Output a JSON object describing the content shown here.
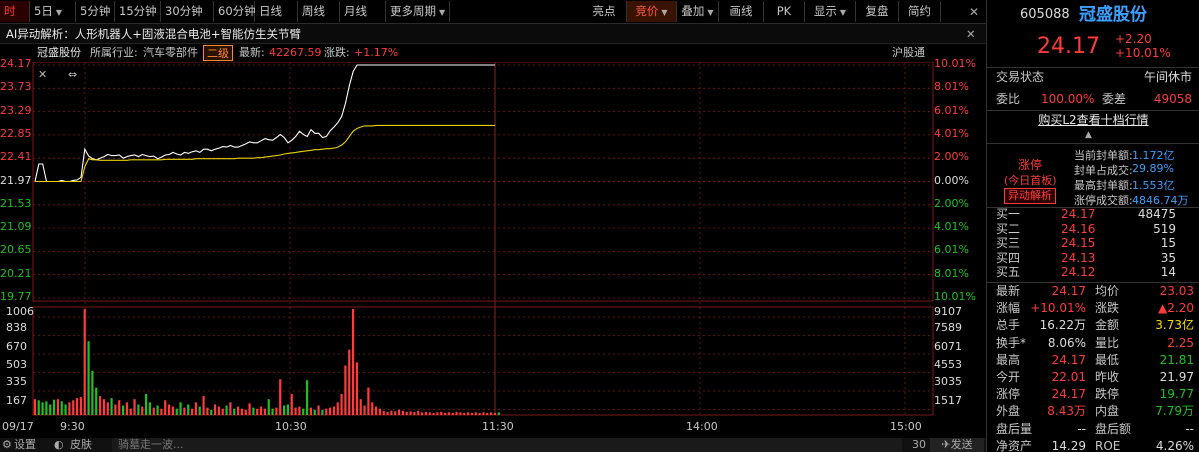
{
  "toolbar": {
    "left_items": [
      {
        "label": "时"
      },
      {
        "label": "5日"
      },
      {
        "label": "5分钟"
      },
      {
        "label": "15分钟"
      },
      {
        "label": "30分钟"
      },
      {
        "label": "60分钟"
      },
      {
        "label": "日线"
      },
      {
        "label": "周线"
      },
      {
        "label": "月线"
      },
      {
        "label": "更多周期"
      }
    ],
    "right_items": [
      {
        "label": "亮点"
      },
      {
        "label": "竞价"
      },
      {
        "label": "叠加"
      },
      {
        "label": "画线"
      },
      {
        "label": "PK"
      },
      {
        "label": "显示"
      },
      {
        "label": "复盘"
      },
      {
        "label": "简约"
      }
    ]
  },
  "ai_bar": {
    "text": "AI异动解析：人形机器人+固液混合电池+智能仿生关节臂"
  },
  "chart_header": {
    "name": "冠盛股份",
    "industry_label": "所属行业:",
    "industry": "汽车零部件",
    "level": "二级",
    "latest_label": "最新:",
    "latest": "42267.59",
    "change_label": "涨跌:",
    "change": "+1.17%",
    "connect": "沪股通"
  },
  "price_axis": {
    "left": [
      "24.17",
      "23.73",
      "23.29",
      "22.85",
      "22.41",
      "21.97",
      "21.53",
      "21.09",
      "20.65",
      "20.21",
      "19.77"
    ],
    "right": [
      "10.01%",
      "8.01%",
      "6.01%",
      "4.01%",
      "2.00%",
      "0.00%",
      "2.00%",
      "4.01%",
      "6.01%",
      "8.01%",
      "10.01%"
    ]
  },
  "volume_axis": {
    "left": [
      "1006",
      "838",
      "670",
      "503",
      "335",
      "167"
    ],
    "right": [
      "9107",
      "7589",
      "6071",
      "4553",
      "3035",
      "1517"
    ]
  },
  "time_axis": [
    "09/17",
    "9:30",
    "10:30",
    "11:30",
    "14:00",
    "15:00"
  ],
  "bottom_bar": {
    "settings": "设置",
    "skin": "皮肤",
    "ticker": "骑墓走一波...",
    "count": "30",
    "send": "发送"
  },
  "chart_data": {
    "type": "line",
    "ylim": [
      19.77,
      24.17
    ],
    "prev_close": 21.97,
    "series": [
      {
        "values": [
          21.97,
          22.3,
          22.3,
          21.97,
          21.97,
          21.97,
          21.97,
          21.99,
          21.97,
          21.97,
          21.99,
          22.0,
          22.05,
          22.58,
          22.45,
          22.4,
          22.38,
          22.41,
          22.44,
          22.48,
          22.46,
          22.46,
          22.47,
          22.41,
          22.44,
          22.46,
          22.47,
          22.44,
          22.48,
          22.46,
          22.44,
          22.45,
          22.4,
          22.43,
          22.47,
          22.48,
          22.52,
          22.49,
          22.47,
          22.52,
          22.5,
          22.53,
          22.55,
          22.52,
          22.58,
          22.58,
          22.55,
          22.58,
          22.6,
          22.63,
          22.62,
          22.65,
          22.62,
          22.62,
          22.65,
          22.68,
          22.72,
          22.7,
          22.7,
          22.74,
          22.78,
          22.76,
          22.75,
          22.8,
          22.86,
          22.8,
          22.7,
          22.75,
          22.82,
          22.92,
          22.86,
          22.82,
          22.95,
          22.88,
          22.88,
          22.8,
          22.82,
          22.93,
          23.0,
          23.08,
          23.2,
          23.45,
          23.78,
          24.05,
          24.17,
          24.17,
          24.17,
          24.17,
          24.17,
          24.17,
          24.17,
          24.17,
          24.17,
          24.17,
          24.17,
          24.17,
          24.17,
          24.17,
          24.17,
          24.17,
          24.17,
          24.17,
          24.17,
          24.17,
          24.17,
          24.17,
          24.17,
          24.17,
          24.17,
          24.17,
          24.17,
          24.17,
          24.17,
          24.17,
          24.17,
          24.17,
          24.17,
          24.17,
          24.17,
          24.17,
          24.17
        ]
      },
      {
        "values": [
          21.97,
          21.97,
          21.97,
          21.97,
          21.97,
          21.97,
          21.97,
          21.97,
          21.97,
          21.97,
          21.97,
          21.97,
          21.97,
          22.25,
          22.4,
          22.38,
          22.38,
          22.37,
          22.37,
          22.37,
          22.37,
          22.37,
          22.37,
          22.37,
          22.37,
          22.38,
          22.38,
          22.38,
          22.38,
          22.38,
          22.38,
          22.38,
          22.38,
          22.38,
          22.39,
          22.39,
          22.39,
          22.39,
          22.39,
          22.39,
          22.39,
          22.39,
          22.4,
          22.4,
          22.4,
          22.4,
          22.4,
          22.4,
          22.4,
          22.4,
          22.4,
          22.4,
          22.4,
          22.41,
          22.41,
          22.41,
          22.41,
          22.41,
          22.42,
          22.42,
          22.43,
          22.44,
          22.45,
          22.46,
          22.47,
          22.49,
          22.5,
          22.51,
          22.52,
          22.53,
          22.54,
          22.55,
          22.56,
          22.57,
          22.57,
          22.58,
          22.59,
          22.59,
          22.6,
          22.62,
          22.66,
          22.72,
          22.82,
          22.92,
          22.97,
          23.0,
          23.02,
          23.02,
          23.02,
          23.03,
          23.03,
          23.03,
          23.03,
          23.03,
          23.03,
          23.03,
          23.03,
          23.03,
          23.03,
          23.03,
          23.03,
          23.03,
          23.03,
          23.03,
          23.03,
          23.03,
          23.03,
          23.03,
          23.03,
          23.03,
          23.03,
          23.03,
          23.03,
          23.03,
          23.03,
          23.03,
          23.03,
          23.03,
          23.03,
          23.03,
          23.03
        ]
      }
    ],
    "volume_ylim": [
      0,
      1006
    ],
    "volume": [
      150,
      140,
      120,
      130,
      100,
      145,
      150,
      130,
      100,
      120,
      140,
      160,
      170,
      1006,
      700,
      420,
      260,
      180,
      150,
      120,
      160,
      100,
      140,
      90,
      120,
      60,
      150,
      100,
      80,
      200,
      120,
      70,
      90,
      60,
      140,
      100,
      80,
      60,
      120,
      70,
      100,
      60,
      120,
      80,
      180,
      70,
      50,
      100,
      80,
      60,
      90,
      120,
      60,
      80,
      60,
      50,
      110,
      70,
      60,
      80,
      60,
      150,
      60,
      70,
      340,
      90,
      100,
      200,
      70,
      80,
      60,
      330,
      70,
      50,
      90,
      50,
      60,
      70,
      80,
      120,
      200,
      470,
      620,
      1006,
      500,
      150,
      90,
      260,
      120,
      80,
      60,
      40,
      30,
      40,
      35,
      50,
      40,
      30,
      35,
      30,
      40,
      25,
      30,
      25,
      20,
      25,
      30,
      20,
      25,
      20,
      30,
      25,
      20,
      25,
      20,
      25,
      20,
      25,
      20,
      25,
      20,
      25
    ]
  },
  "panel": {
    "code": "605088",
    "name": "冠盛股份",
    "price": "24.17",
    "change": "+2.20",
    "pct": "+10.01%",
    "trade_status_label": "交易状态",
    "trade_status": "午间休市",
    "wb_label": "委比",
    "wb": "100.00%",
    "wc_label": "委差",
    "wc": "49058",
    "l2_link": "购买L2查看十档行情",
    "limit_title": "涨停",
    "limit_sub": "(今日首板)",
    "abnormal": "异动解析",
    "seal_rows": [
      {
        "label": "当前封单额:",
        "value": "1.172亿"
      },
      {
        "label": "封单占成交:",
        "value": "29.89%"
      },
      {
        "label": "最高封单额:",
        "value": "1.553亿"
      },
      {
        "label": "涨停成交额:",
        "value": "4846.74万"
      }
    ],
    "bids": [
      {
        "label": "买一",
        "price": "24.17",
        "vol": "48475"
      },
      {
        "label": "买二",
        "price": "24.16",
        "vol": "519"
      },
      {
        "label": "买三",
        "price": "24.15",
        "vol": "15"
      },
      {
        "label": "买四",
        "price": "24.13",
        "vol": "35"
      },
      {
        "label": "买五",
        "price": "24.12",
        "vol": "14"
      }
    ],
    "stats": [
      {
        "l1": "最新",
        "v1": "24.17",
        "c1": "red",
        "l2": "均价",
        "v2": "23.03",
        "c2": "red"
      },
      {
        "l1": "涨幅",
        "v1": "+10.01%",
        "c1": "red",
        "l2": "涨跌",
        "v2": "▲2.20",
        "c2": "red"
      },
      {
        "l1": "总手",
        "v1": "16.22万",
        "c1": "white",
        "l2": "金额",
        "v2": "3.73亿",
        "c2": "yellow"
      },
      {
        "l1": "换手*",
        "v1": "8.06%",
        "c1": "white",
        "l2": "量比",
        "v2": "2.25",
        "c2": "red"
      },
      {
        "l1": "最高",
        "v1": "24.17",
        "c1": "red",
        "l2": "最低",
        "v2": "21.81",
        "c2": "green"
      },
      {
        "l1": "今开",
        "v1": "22.01",
        "c1": "red",
        "l2": "昨收",
        "v2": "21.97",
        "c2": "white"
      },
      {
        "l1": "涨停",
        "v1": "24.17",
        "c1": "red",
        "l2": "跌停",
        "v2": "19.77",
        "c2": "green"
      },
      {
        "l1": "外盘",
        "v1": "8.43万",
        "c1": "red",
        "l2": "内盘",
        "v2": "7.79万",
        "c2": "green"
      },
      {
        "l1": "盘后量",
        "v1": "--",
        "c1": "white",
        "l2": "盘后额",
        "v2": "--",
        "c2": "white"
      },
      {
        "l1": "净资产",
        "v1": "14.29",
        "c1": "white",
        "l2": "ROE",
        "v2": "4.26%",
        "c2": "white"
      }
    ]
  },
  "colors": {
    "up": "#ff3b3b",
    "down": "#20c020",
    "price_line": "#ffffff",
    "avg_line": "#e6d200",
    "grid": "#7a1a1a"
  }
}
